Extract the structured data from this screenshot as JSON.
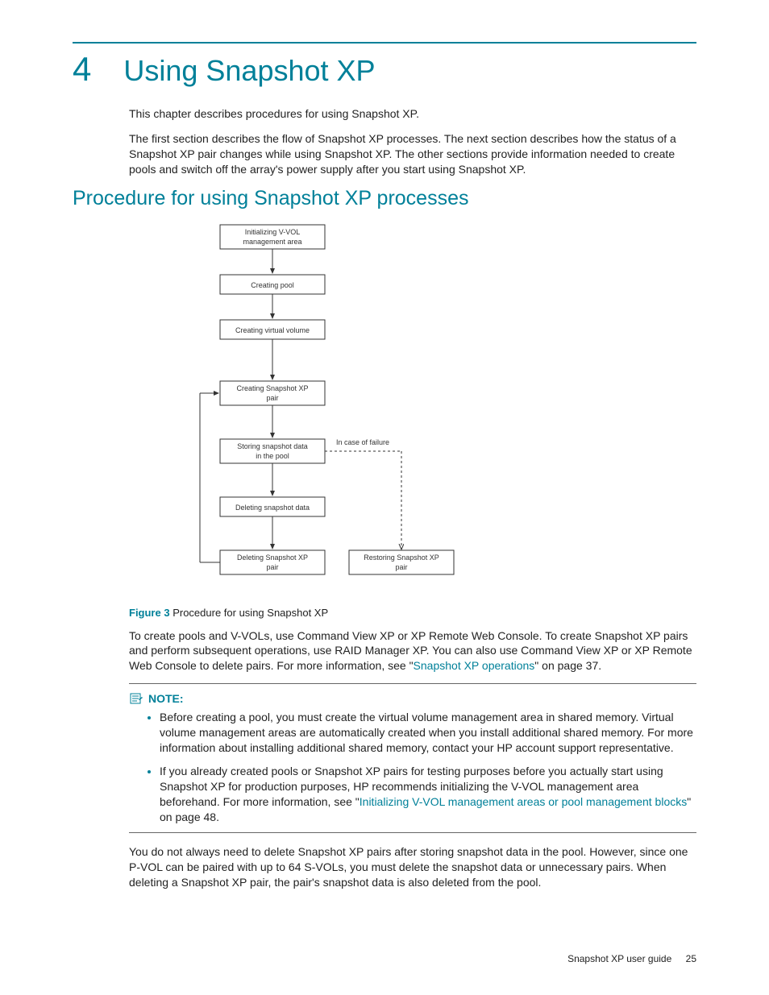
{
  "chapter": {
    "number": "4",
    "title": "Using Snapshot XP"
  },
  "intro": {
    "p1": "This chapter describes procedures for using Snapshot XP.",
    "p2": "The first section describes the flow of Snapshot XP processes. The next section describes how the status of a Snapshot XP pair changes while using Snapshot XP. The other sections provide information needed to create pools and switch off the array's power supply after you start using Snapshot XP."
  },
  "section": {
    "title": "Procedure for using Snapshot XP processes"
  },
  "flowchart": {
    "boxes": {
      "b1": "Initializing V-VOL\nmanagement area",
      "b2": "Creating pool",
      "b3": "Creating virtual volume",
      "b4": "Creating Snapshot XP\npair",
      "b5": "Storing snapshot data\nin the pool",
      "b6": "Deleting snapshot data",
      "b7": "Deleting Snapshot XP\npair",
      "b8": "Restoring Snapshot XP\npair"
    },
    "edge_label": "In case of failure"
  },
  "figure": {
    "label": "Figure 3",
    "caption": "Procedure for using Snapshot XP"
  },
  "para_create": {
    "pre": "To create pools and V-VOLs, use Command View XP or XP Remote Web Console. To create Snapshot XP pairs and perform subsequent operations, use RAID Manager XP. You can also use Command View XP or XP Remote Web Console to delete pairs. For more information, see \"",
    "link": "Snapshot XP operations",
    "post": "\" on page 37."
  },
  "note": {
    "label": "NOTE:",
    "item1": "Before creating a pool, you must create the virtual volume management area in shared memory. Virtual volume management areas are automatically created when you install additional shared memory. For more information about installing additional shared memory, contact your HP account support representative.",
    "item2_pre": "If you already created pools or Snapshot XP pairs for testing purposes before you actually start using Snapshot XP for production purposes, HP recommends initializing the V-VOL management area beforehand. For more information, see \"",
    "item2_link": "Initializing V-VOL management areas or pool management blocks",
    "item2_post": "\" on page 48."
  },
  "para_delete": "You do not always need to delete Snapshot XP pairs after storing snapshot data in the pool. However, since one P-VOL can be paired with up to 64 S-VOLs, you must delete the snapshot data or unnecessary pairs. When deleting a Snapshot XP pair, the pair's snapshot data is also deleted from the pool.",
  "footer": {
    "doc": "Snapshot XP user guide",
    "page": "25"
  }
}
